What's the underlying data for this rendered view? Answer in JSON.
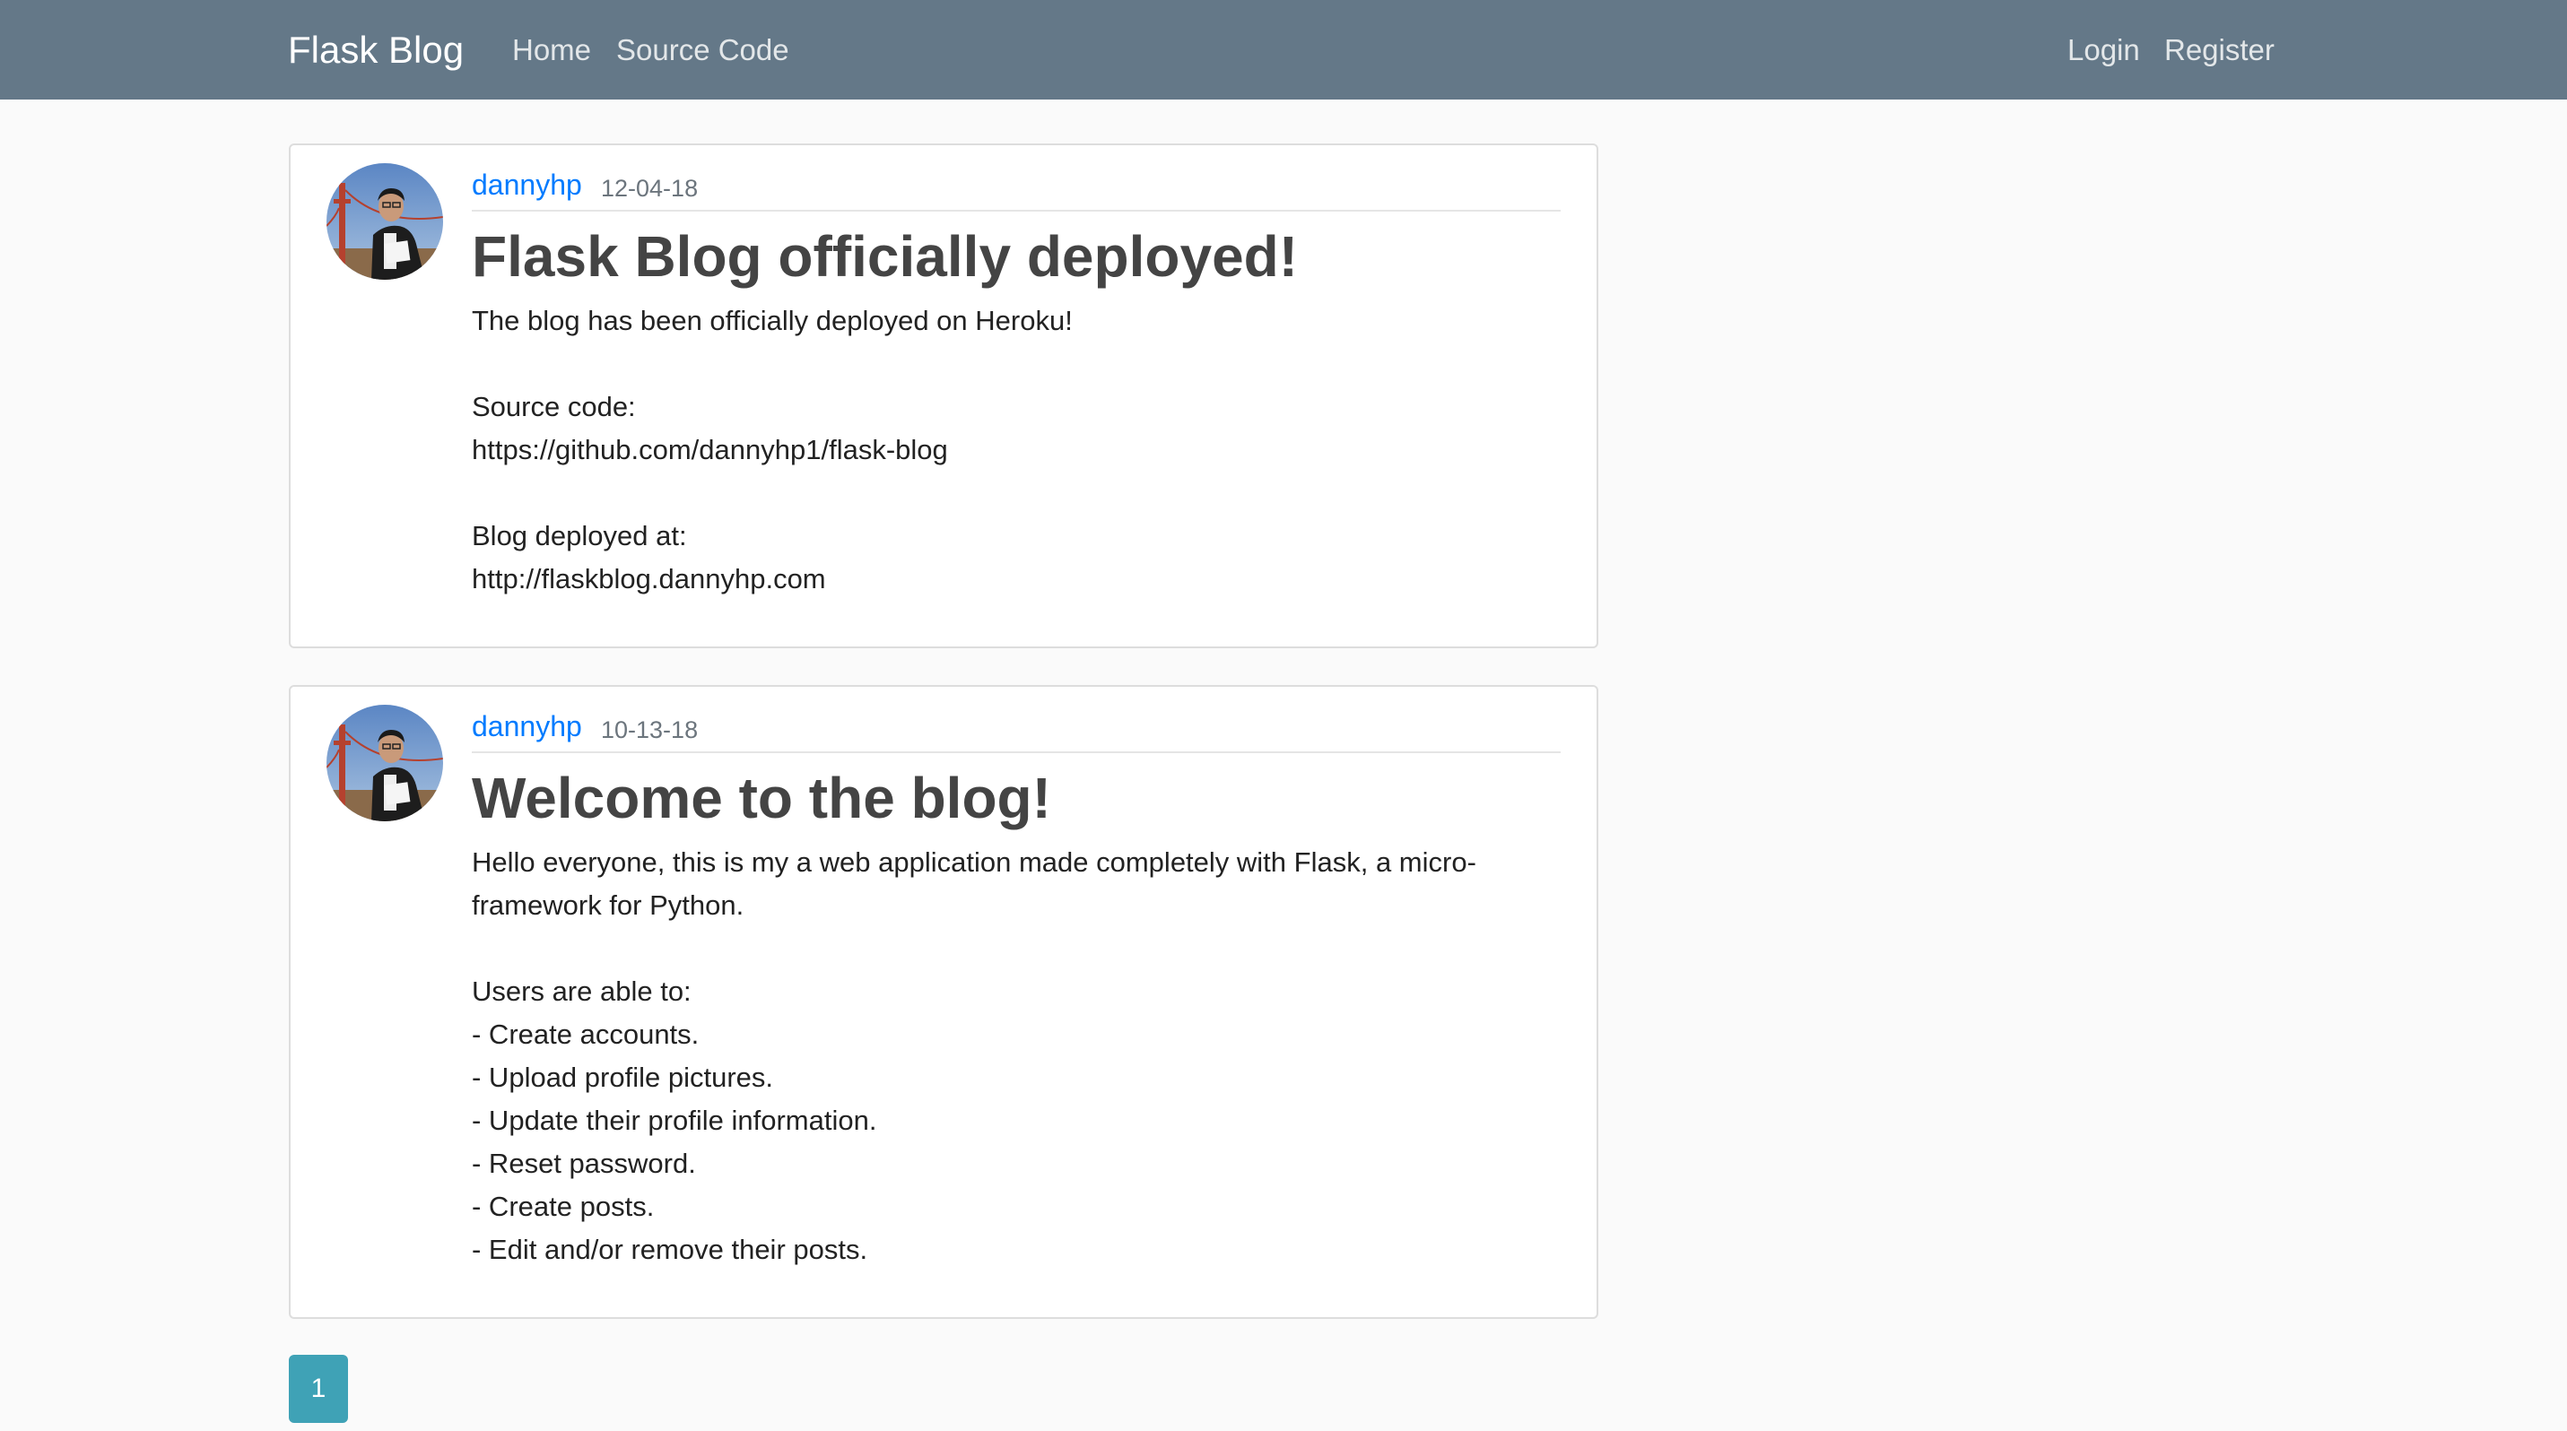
{
  "navbar": {
    "brand": "Flask Blog",
    "links": {
      "home": "Home",
      "source": "Source Code",
      "login": "Login",
      "register": "Register"
    },
    "background_color": "#647888"
  },
  "posts": [
    {
      "author": "dannyhp",
      "date": "12-04-18",
      "title": "Flask Blog officially deployed!",
      "content": "The blog has been officially deployed on Heroku!\n\nSource code:\nhttps://github.com/dannyhp1/flask-blog\n\nBlog deployed at:\nhttp://flaskblog.dannyhp.com"
    },
    {
      "author": "dannyhp",
      "date": "10-13-18",
      "title": "Welcome to the blog!",
      "content": "Hello everyone, this is my a web application made completely with Flask, a micro-\nframework for Python.\n\nUsers are able to:\n- Create accounts.\n- Upload profile pictures.\n- Update their profile information.\n- Reset password.\n- Create posts.\n- Edit and/or remove their posts."
    }
  ],
  "pagination": {
    "pages": [
      "1"
    ],
    "active_color": "#3fa2b6"
  },
  "colors": {
    "link": "#007bff",
    "muted": "#6c757d"
  }
}
